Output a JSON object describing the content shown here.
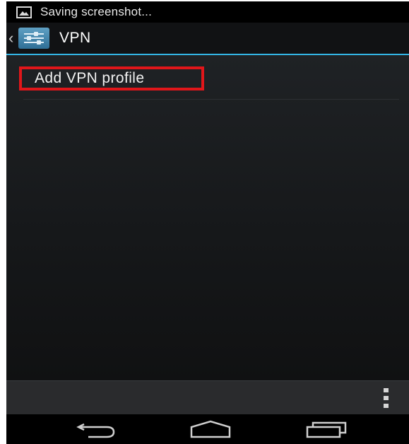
{
  "status_bar": {
    "notification_icon": "image-icon",
    "text": "Saving screenshot..."
  },
  "action_bar": {
    "back_icon": "chevron-left-icon",
    "app_icon": "settings-sliders-icon",
    "title": "VPN",
    "accent_color": "#33b5e5"
  },
  "content": {
    "add_vpn_label": "Add VPN profile",
    "highlight_color": "#e0161a"
  },
  "bottom_bar": {
    "overflow_icon": "overflow-menu-icon"
  },
  "nav_bar": {
    "back_icon": "back-arrow-icon",
    "home_icon": "home-icon",
    "recents_icon": "recent-apps-icon"
  }
}
